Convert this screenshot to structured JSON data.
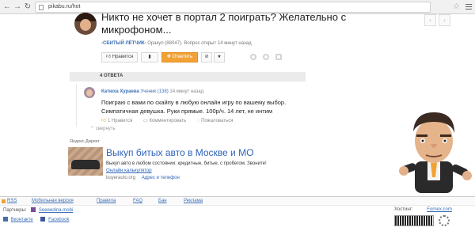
{
  "browser": {
    "url": "pikabu.ru/hot"
  },
  "post": {
    "title": "Никто не хочет в портал 2 поиграть? Желательно с микрофоном...",
    "author": "-СБИТЫЙ ЛЁТЧИК-",
    "author_info": "Оракул (88047). Вопрос открыт 14 минут назад",
    "actions": {
      "like": "Нравится",
      "reply": "Ответить"
    }
  },
  "answers": {
    "count_label": "4 ОТВЕТА"
  },
  "comment": {
    "name": "Катюха Хураева",
    "rank": "Ученик (138)",
    "time": "14 минут назад",
    "text": "Поиграю с вами по скайпу в любую онлайн игру по вашему выбор. Симпатичная девушка. Руки прямые. 100р/ч. 14 лет, не интим",
    "likes": "1 Нравится",
    "comment_action": "Комментировать",
    "report_action": "Пожаловаться",
    "collapse": "свернуть"
  },
  "ad": {
    "label": "Яндекс.Директ",
    "title": "Выкуп битых авто в Москве и МО",
    "description": "Выкуп авто в любом состоянии: кредитные, битые, с пробегом. Звоните!",
    "link": "Онлайн калькулятор",
    "domain": "buyerauto.org",
    "address": "Адрес и телефон"
  },
  "footer": {
    "links": [
      "RSS",
      "Мобильная версия",
      "Правила",
      "FAQ",
      "Бан",
      "Реклама"
    ],
    "partners_label": "Партнеры:",
    "partner": "Seeeedina.mobi",
    "social": [
      "Вконтакте",
      "Facebook"
    ],
    "hosting_label": "Хостинг:",
    "hosting_link": "Fornex.com"
  },
  "colors": {
    "accent": "#f2a235",
    "link": "#3a6fb5"
  }
}
